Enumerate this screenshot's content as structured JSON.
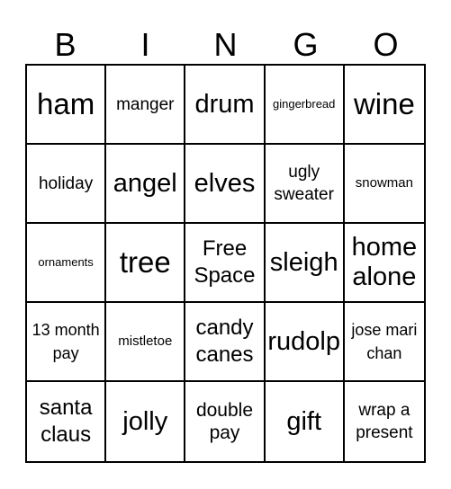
{
  "title_letters": [
    "B",
    "I",
    "N",
    "G",
    "O"
  ],
  "cells": [
    [
      "ham",
      "manger",
      "drum",
      "gingerbread",
      "wine"
    ],
    [
      "holiday",
      "angel",
      "elves",
      "ugly sweater",
      "snowman"
    ],
    [
      "ornaments",
      "tree",
      "Free Space",
      "sleigh",
      "home alone"
    ],
    [
      "13 month pay",
      "mistletoe",
      "candy canes",
      "rudolp",
      "jose mari chan"
    ],
    [
      "santa claus",
      "jolly",
      "double pay",
      "gift",
      "wrap a present"
    ]
  ]
}
